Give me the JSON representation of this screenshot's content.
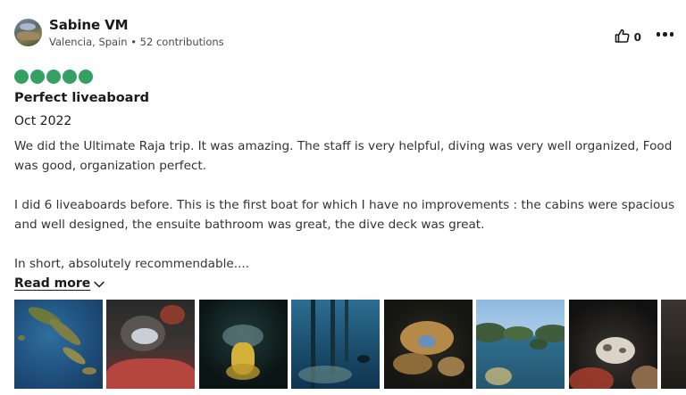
{
  "review": {
    "user": {
      "name": "Sabine VM",
      "meta": "Valencia, Spain • 52 contributions"
    },
    "helpful_count": "0",
    "rating": {
      "value": 5,
      "max": 5,
      "color": "#34a062"
    },
    "title": "Perfect liveaboard",
    "date": "Oct 2022",
    "paragraphs": [
      "We did the Ultimate Raja trip. It was amazing. The staff is very helpful, diving was very well organized, Food was good, organization perfect.",
      "I did 6 liveaboards before. This is the first boat for which I have no improvements : the cabins were spacious and well designed, the ensuite bathroom was great, the dive deck was great.",
      "In short, absolutely recommendable...."
    ],
    "read_more_label": "Read more",
    "photos": [
      {
        "icon": "aerial-islands-photo"
      },
      {
        "icon": "fish-in-coral-photo"
      },
      {
        "icon": "jellyfish-photo"
      },
      {
        "icon": "jetty-underwater-photo"
      },
      {
        "icon": "nudibranch-photo"
      },
      {
        "icon": "raja-ampat-islands-photo"
      },
      {
        "icon": "octopus-photo"
      },
      {
        "icon": "partial-photo"
      }
    ]
  }
}
